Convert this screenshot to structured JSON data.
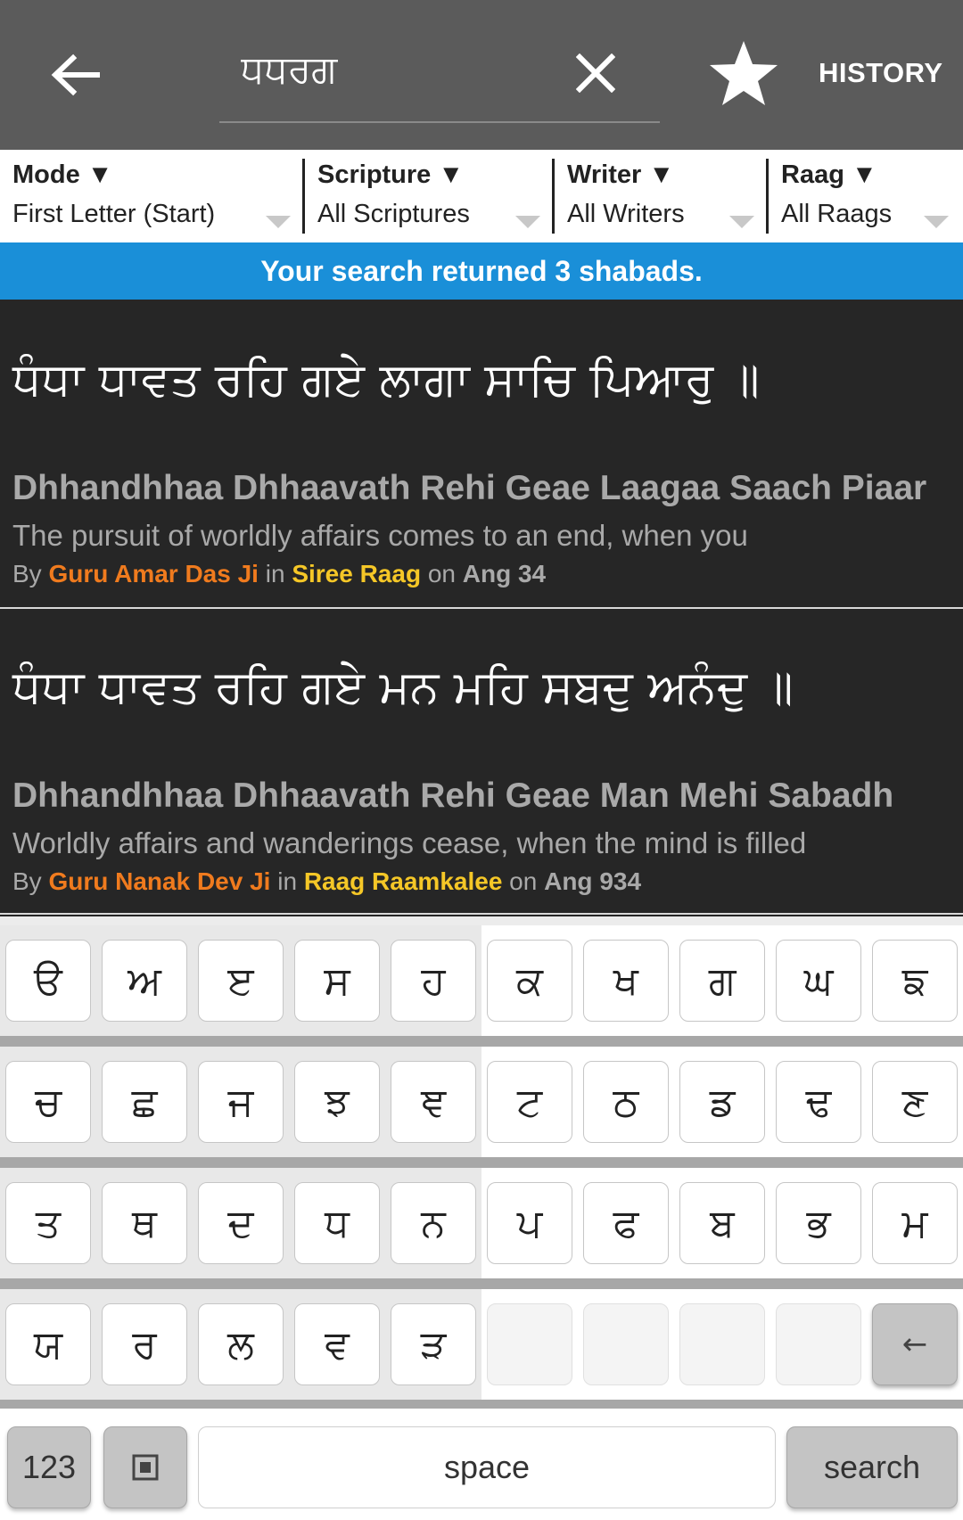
{
  "header": {
    "search_value": "ਧਧਰਗ",
    "history_label": "HISTORY",
    "icons": {
      "back": "back-arrow-icon",
      "clear": "close-icon",
      "favorite": "star-icon"
    }
  },
  "filters": [
    {
      "title": "Mode ▼",
      "value": "First Letter (Start)"
    },
    {
      "title": "Scripture ▼",
      "value": "All Scriptures"
    },
    {
      "title": "Writer ▼",
      "value": "All Writers"
    },
    {
      "title": "Raag ▼",
      "value": "All Raags"
    }
  ],
  "banner": "Your search returned 3 shabads.",
  "results": [
    {
      "gurmukhi": "ਧੰਧਾ ਧਾਵਤ ਰਹਿ ਗਏ ਲਾਗਾ ਸਾਚਿ ਪਿਆਰੁ ॥",
      "transliteration": "Dhhandhhaa Dhhaavath Rehi Geae Laagaa Saach Piaar",
      "translation": "The pursuit of worldly affairs comes to an end, when you",
      "by": "By",
      "writer": "Guru Amar Das Ji",
      "in": "in",
      "raag": "Siree Raag",
      "on": "on",
      "ang": "Ang 34"
    },
    {
      "gurmukhi": "ਧੰਧਾ ਧਾਵਤ ਰਹਿ ਗਏ ਮਨ ਮਹਿ ਸਬਦੁ ਅਨੰਦੁ ॥",
      "transliteration": "Dhhandhhaa Dhhaavath Rehi Geae Man Mehi Sabadh",
      "translation": "Worldly affairs and wanderings cease, when the mind is filled",
      "by": "By",
      "writer": "Guru Nanak Dev Ji",
      "in": "in",
      "raag": "Raag Raamkalee",
      "on": "on",
      "ang": "Ang 934"
    }
  ],
  "keyboard": {
    "rows": [
      [
        "ੳ",
        "ਅ",
        "ੲ",
        "ਸ",
        "ਹ",
        "ਕ",
        "ਖ",
        "ਗ",
        "ਘ",
        "ਙ"
      ],
      [
        "ਚ",
        "ਛ",
        "ਜ",
        "ਝ",
        "ਞ",
        "ਟ",
        "ਠ",
        "ਡ",
        "ਢ",
        "ਣ"
      ],
      [
        "ਤ",
        "ਥ",
        "ਦ",
        "ਧ",
        "ਨ",
        "ਪ",
        "ਫ",
        "ਬ",
        "ਭ",
        "ਮ"
      ],
      [
        "ਯ",
        "ਰ",
        "ਲ",
        "ਵ",
        "ੜ",
        "",
        "",
        "",
        "",
        "←"
      ]
    ],
    "numbers_label": "123",
    "space_label": "space",
    "search_label": "search",
    "mode_icon": "square-toggle-icon"
  },
  "colors": {
    "appbar": "#5b5b5b",
    "banner": "#1a8fd8",
    "results_bg": "#262626",
    "writer": "#f07b1e",
    "raag": "#f5c727"
  }
}
